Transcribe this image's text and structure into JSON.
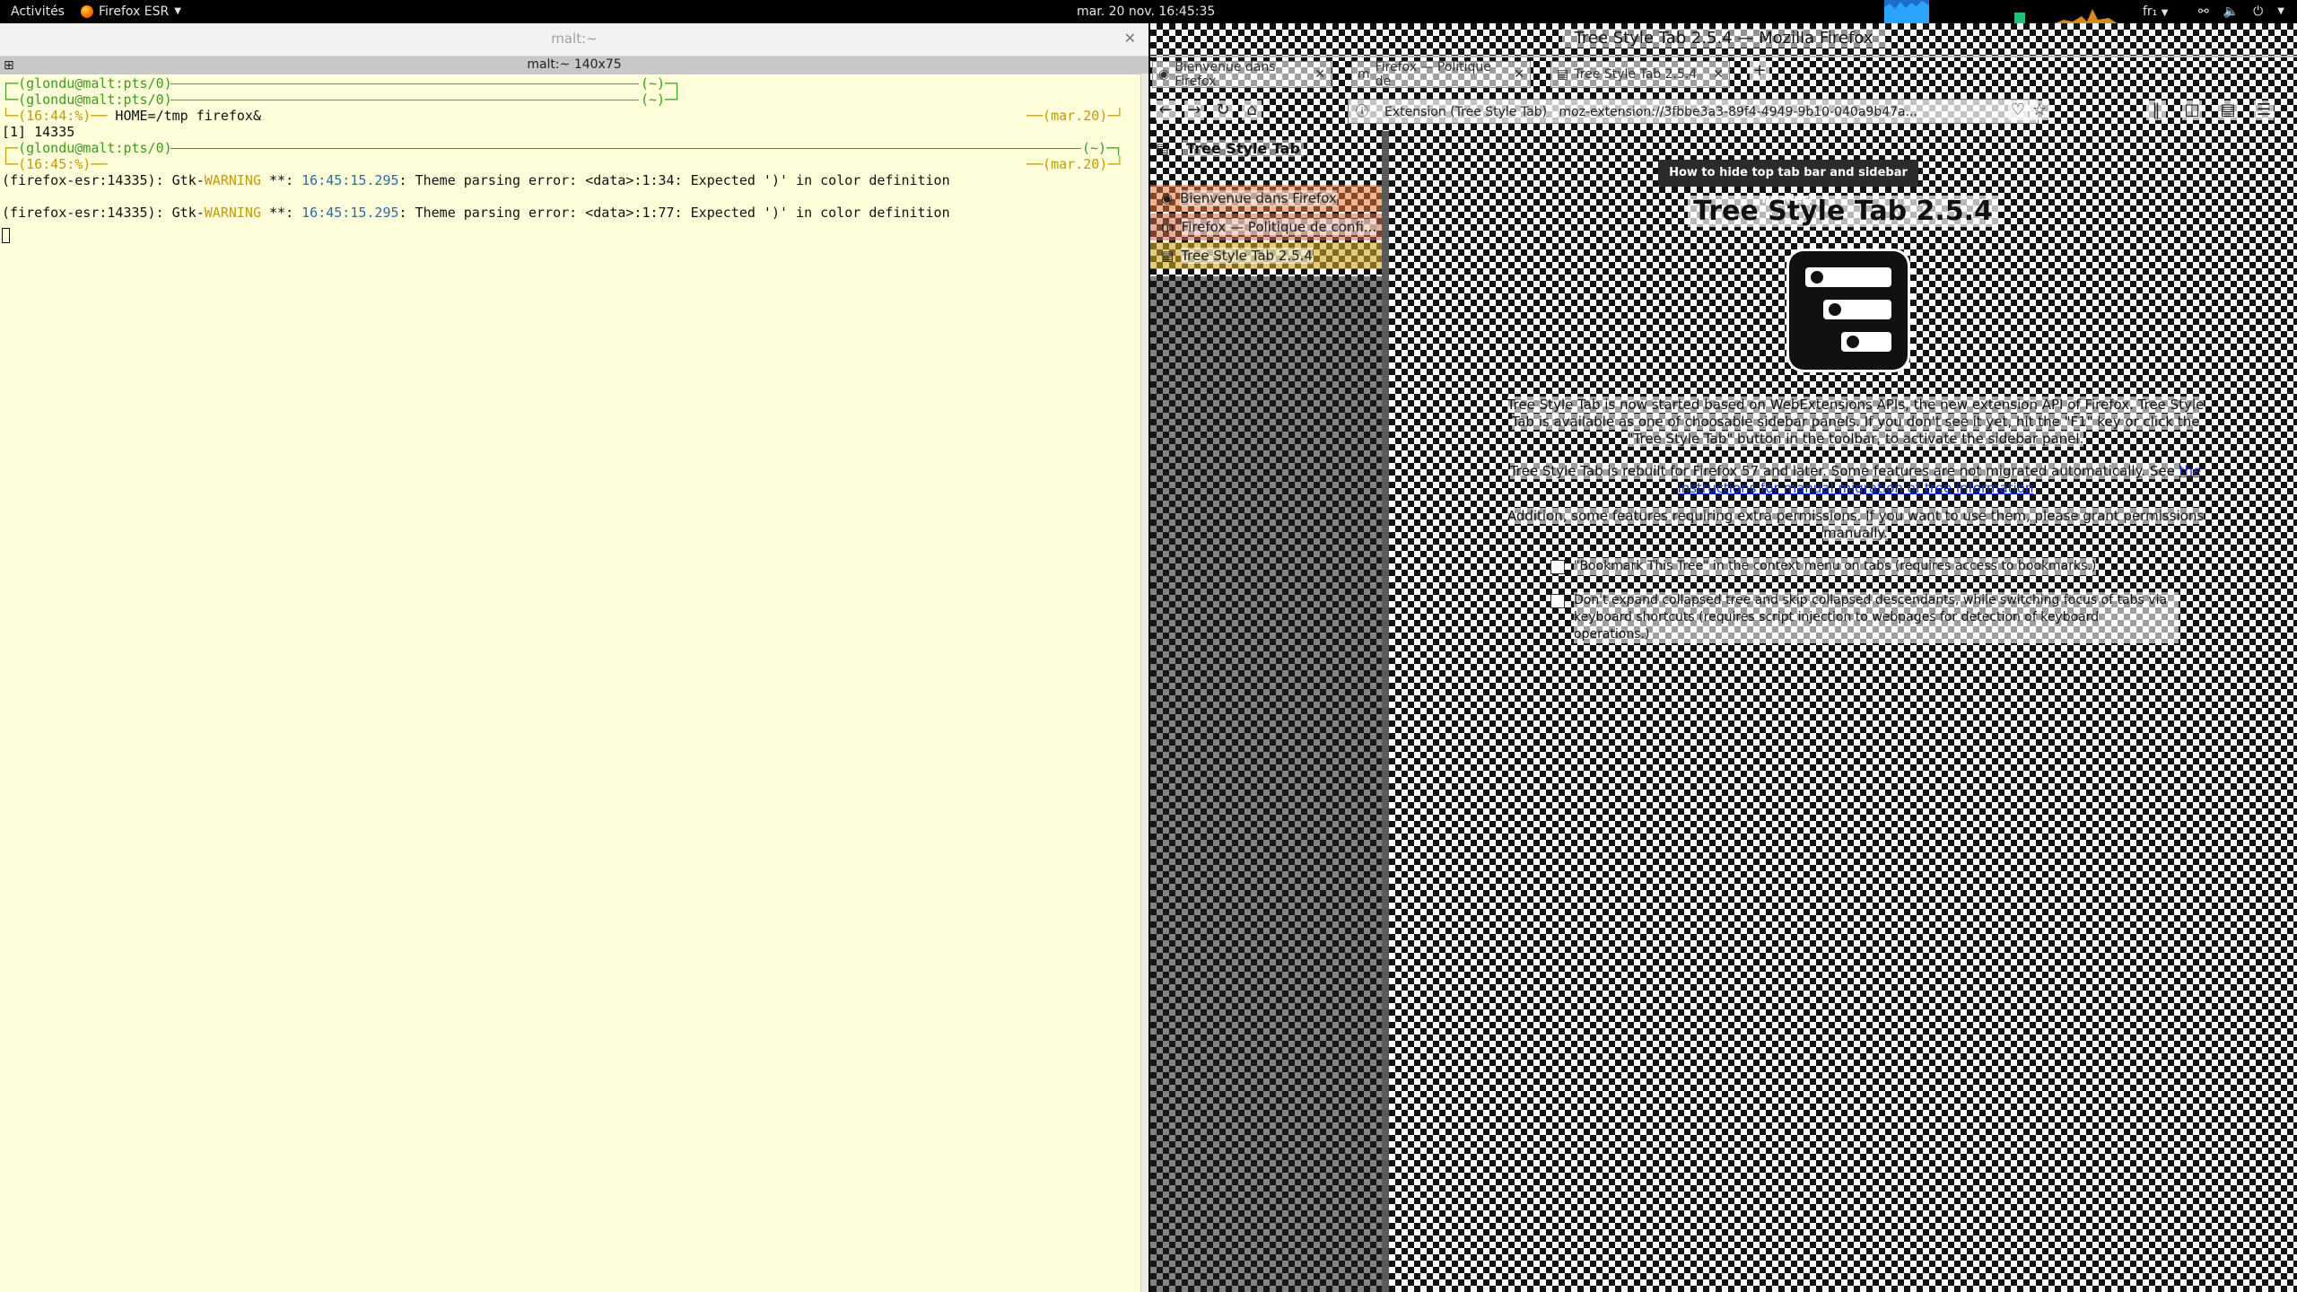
{
  "topbar": {
    "activities": "Activités",
    "app_name": "Firefox ESR",
    "clock": "mar. 20 nov.  16:45:35",
    "keyboard_layout": "fr₁"
  },
  "terminal": {
    "window_title": "malt:~",
    "tab_title": "malt:~ 140x75",
    "lines": {
      "l1_user": "(glondu@malt:pts/0)",
      "l1_right": "(~)",
      "l2_user": "(glondu@malt:pts/0)",
      "l2_right": "(~)",
      "l3_time": "(16:44:%)",
      "l3_cmd": " HOME=/tmp firefox&",
      "l3_date": "(mar.20)",
      "l4": "[1] 14335",
      "l5_user": "(glondu@malt:pts/0)",
      "l5_right": "(~)",
      "l6_time": "(16:45:%)",
      "l6_date": "(mar.20)",
      "w1_pre": "(firefox-esr:14335): Gtk-",
      "w1_warn": "WARNING",
      "w1_mid": " **: ",
      "w1_time": "16:45:15.295",
      "w1_msg": ": Theme parsing error: <data>:1:34: Expected ')' in color definition",
      "w2_pre": "(firefox-esr:14335): Gtk-",
      "w2_warn": "WARNING",
      "w2_mid": " **: ",
      "w2_time": "16:45:15.295",
      "w2_msg": ": Theme parsing error: <data>:1:77: Expected ')' in color definition"
    }
  },
  "firefox": {
    "window_title": "Tree Style Tab 2.5.4 — Mozilla Firefox",
    "tabs": [
      {
        "label": "Bienvenue dans Firefox"
      },
      {
        "label": "Firefox — Politique de"
      },
      {
        "label": "Tree Style Tab 2.5.4"
      }
    ],
    "url_identity": "Extension (Tree Style Tab)",
    "url": "moz-extension://3fbbe3a3-89f4-4949-9b10-040a9b47a..."
  },
  "sidebar": {
    "title": "Tree Style Tab",
    "tabs": [
      {
        "label": "Bienvenue dans Firefox"
      },
      {
        "label": "Firefox — Politique de confi..."
      },
      {
        "label": "Tree Style Tab 2.5.4"
      }
    ]
  },
  "page": {
    "tooltip": "How to hide top tab bar and sidebar header?",
    "title": "Tree Style Tab 2.5.4",
    "para1": "Tree Style Tab is now started based on WebExtensions APIs, the new extension API of Firefox. Tree Style Tab is available as one of choosable sidebar panels. If you don't see it yet, hit the \"F1\" key or click the \"Tree Style Tab\" button in the toolbar, to activate the sidebar panel.",
    "para2_text": "Tree Style Tab is rebuilt for Firefox 57 and later. Some features are not migrated automatically. See ",
    "para2_link": "the instructions for manual migration of tree information",
    "para3": "Addition, some features requiring extra permissions. If you want to use them, please grant permissions manually.",
    "perm1": "\"Bookmark This Tree\" in the context menu on tabs (requires access to bookmarks.)",
    "perm2": "Don't expand collapsed tree and skip collapsed descendants, while switching focus of tabs via keyboard shortcuts (requires script injection to webpages for detection of keyboard operations.)"
  }
}
